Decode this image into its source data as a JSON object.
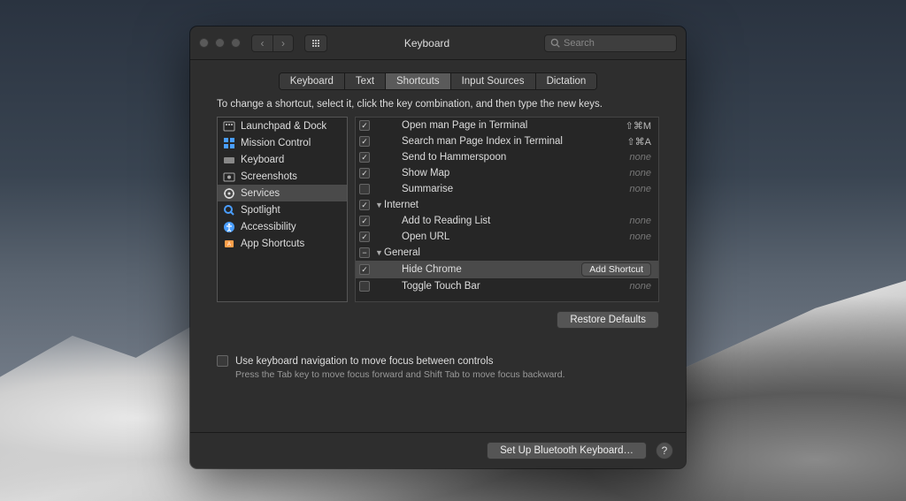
{
  "window": {
    "title": "Keyboard"
  },
  "search": {
    "placeholder": "Search"
  },
  "tabs": [
    "Keyboard",
    "Text",
    "Shortcuts",
    "Input Sources",
    "Dictation"
  ],
  "active_tab": 2,
  "instruction": "To change a shortcut, select it, click the key combination, and then type the new keys.",
  "categories": [
    {
      "icon": "launchpad",
      "label": "Launchpad & Dock"
    },
    {
      "icon": "mission",
      "label": "Mission Control"
    },
    {
      "icon": "keyboard",
      "label": "Keyboard"
    },
    {
      "icon": "screenshot",
      "label": "Screenshots"
    },
    {
      "icon": "services",
      "label": "Services"
    },
    {
      "icon": "spotlight",
      "label": "Spotlight"
    },
    {
      "icon": "accessibility",
      "label": "Accessibility"
    },
    {
      "icon": "appshort",
      "label": "App Shortcuts"
    }
  ],
  "selected_category": 4,
  "shortcuts": [
    {
      "type": "item",
      "checked": true,
      "label": "Open man Page in Terminal",
      "shortcut": "⇧⌘M",
      "indent": 2
    },
    {
      "type": "item",
      "checked": true,
      "label": "Search man Page Index in Terminal",
      "shortcut": "⇧⌘A",
      "indent": 2
    },
    {
      "type": "item",
      "checked": true,
      "label": "Send to Hammerspoon",
      "shortcut": "none",
      "indent": 2
    },
    {
      "type": "item",
      "checked": true,
      "label": "Show Map",
      "shortcut": "none",
      "indent": 2
    },
    {
      "type": "item",
      "checked": false,
      "label": "Summarise",
      "shortcut": "none",
      "indent": 2
    },
    {
      "type": "group",
      "checked": true,
      "label": "Internet",
      "expanded": true
    },
    {
      "type": "item",
      "checked": true,
      "label": "Add to Reading List",
      "shortcut": "none",
      "indent": 2
    },
    {
      "type": "item",
      "checked": true,
      "label": "Open URL",
      "shortcut": "none",
      "indent": 2
    },
    {
      "type": "group",
      "checked": "mixed",
      "label": "General",
      "expanded": true
    },
    {
      "type": "item",
      "checked": true,
      "label": "Hide Chrome",
      "shortcut": "add",
      "indent": 2,
      "selected": true
    },
    {
      "type": "item",
      "checked": false,
      "label": "Toggle Touch Bar",
      "shortcut": "none",
      "indent": 2
    }
  ],
  "buttons": {
    "restore": "Restore Defaults",
    "add_shortcut": "Add Shortcut",
    "bluetooth": "Set Up Bluetooth Keyboard…"
  },
  "nav_option": {
    "label": "Use keyboard navigation to move focus between controls",
    "hint": "Press the Tab key to move focus forward and Shift Tab to move focus backward."
  }
}
